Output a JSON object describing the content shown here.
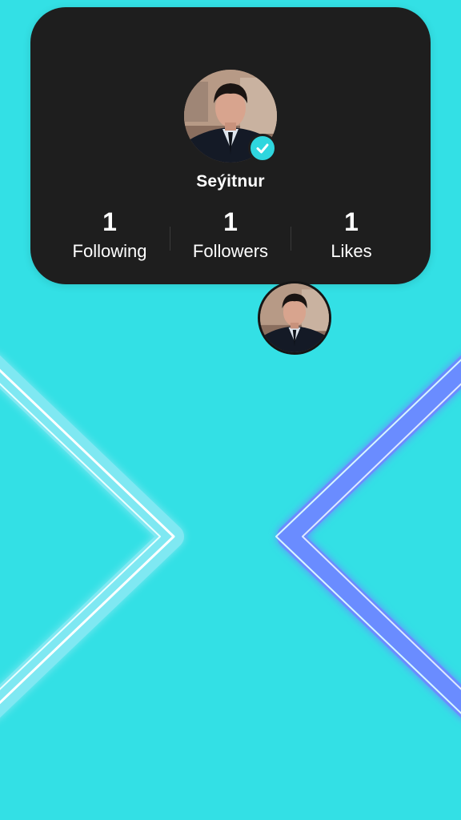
{
  "profile": {
    "username": "Seýitnur",
    "verified": true,
    "avatar": "profile-photo"
  },
  "stats": [
    {
      "value": "1",
      "label": "Following"
    },
    {
      "value": "1",
      "label": "Followers"
    },
    {
      "value": "1",
      "label": "Likes"
    }
  ],
  "colors": {
    "background": "#33e0e5",
    "card": "#1e1e1e",
    "verified_badge": "#2fd6de",
    "left_chevron": "#ffffff",
    "right_chevron": "#6b8cff"
  }
}
